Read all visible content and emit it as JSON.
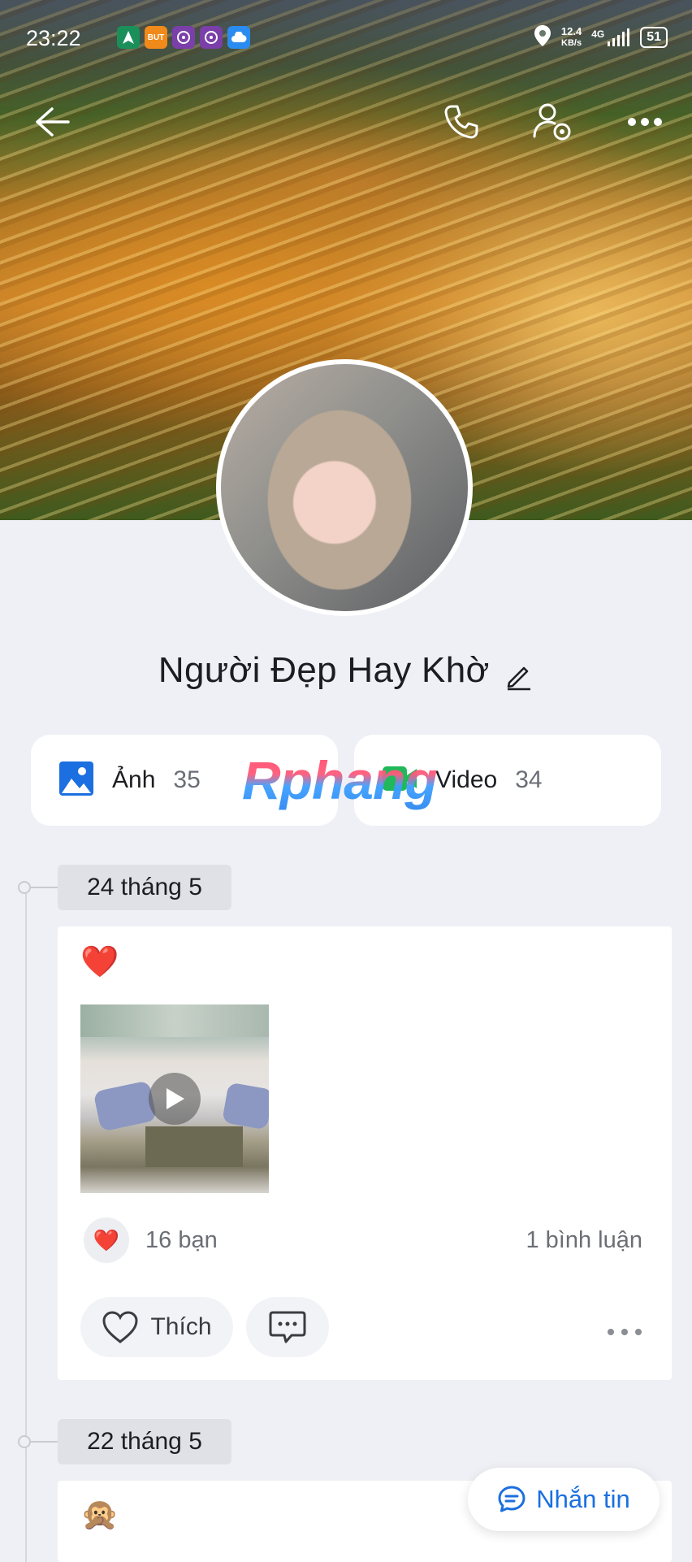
{
  "status_bar": {
    "time": "23:22",
    "speed_value": "12.4",
    "speed_unit": "KB/s",
    "network": "4G",
    "battery": "51",
    "app_icons": [
      "maps-icon",
      "buffer-app-icon",
      "wheel-app-icon",
      "wheel-app-icon-2",
      "cloud-icon"
    ]
  },
  "profile": {
    "name": "Người Đẹp Hay Khờ"
  },
  "media_tiles": [
    {
      "label": "Ảnh",
      "count": "35",
      "icon": "photo-icon"
    },
    {
      "label": "Video",
      "count": "34",
      "icon": "video-icon"
    }
  ],
  "watermark": "Rphang",
  "posts": [
    {
      "date": "24 tháng 5",
      "emoji": "❤️",
      "reaction_emoji": "❤️",
      "reactions": "16 bạn",
      "comments": "1 bình luận",
      "like_label": "Thích"
    },
    {
      "date": "22 tháng 5",
      "emoji": "🙊"
    }
  ],
  "message_button": {
    "label": "Nhắn tin"
  },
  "colors": {
    "accent": "#1b6fe0",
    "background": "#eff0f5",
    "heart": "#e8243c"
  }
}
